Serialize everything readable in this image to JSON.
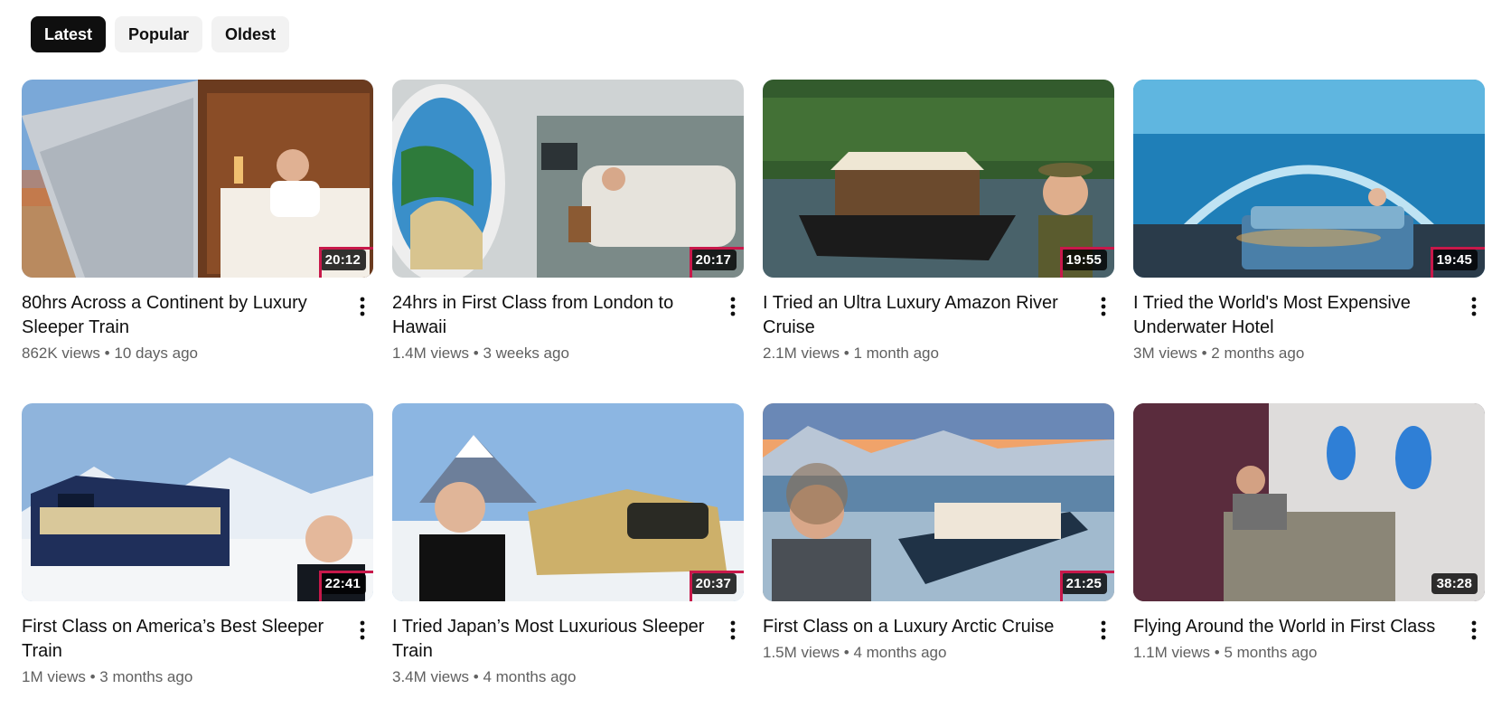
{
  "filters": {
    "chips": [
      {
        "label": "Latest",
        "active": true
      },
      {
        "label": "Popular",
        "active": false
      },
      {
        "label": "Oldest",
        "active": false
      }
    ]
  },
  "colors": {
    "chip_active_bg": "#0f0f0f",
    "chip_bg": "#f2f2f2",
    "highlight_border": "#c8184a",
    "meta_text": "#606060"
  },
  "videos": [
    {
      "title": "80hrs Across a Continent by Luxury Sleeper Train",
      "views": "862K views",
      "age": "10 days ago",
      "duration": "20:12",
      "highlighted": true,
      "icon": "more-vert-icon"
    },
    {
      "title": "24hrs in First Class from London to Hawaii",
      "views": "1.4M views",
      "age": "3 weeks ago",
      "duration": "20:17",
      "highlighted": true,
      "icon": "more-vert-icon"
    },
    {
      "title": "I Tried an Ultra Luxury Amazon River Cruise",
      "views": "2.1M views",
      "age": "1 month ago",
      "duration": "19:55",
      "highlighted": true,
      "icon": "more-vert-icon"
    },
    {
      "title": "I Tried the World's Most Expensive Underwater Hotel",
      "views": "3M views",
      "age": "2 months ago",
      "duration": "19:45",
      "highlighted": true,
      "icon": "more-vert-icon"
    },
    {
      "title": "First Class on America’s Best Sleeper Train",
      "views": "1M views",
      "age": "3 months ago",
      "duration": "22:41",
      "highlighted": true,
      "icon": "more-vert-icon"
    },
    {
      "title": "I Tried Japan’s Most Luxurious Sleeper Train",
      "views": "3.4M views",
      "age": "4 months ago",
      "duration": "20:37",
      "highlighted": true,
      "icon": "more-vert-icon"
    },
    {
      "title": "First Class on a Luxury Arctic Cruise",
      "views": "1.5M views",
      "age": "4 months ago",
      "duration": "21:25",
      "highlighted": true,
      "icon": "more-vert-icon"
    },
    {
      "title": "Flying Around the World in First Class",
      "views": "1.1M views",
      "age": "5 months ago",
      "duration": "38:28",
      "highlighted": false,
      "icon": "more-vert-icon"
    }
  ],
  "separator": "•"
}
